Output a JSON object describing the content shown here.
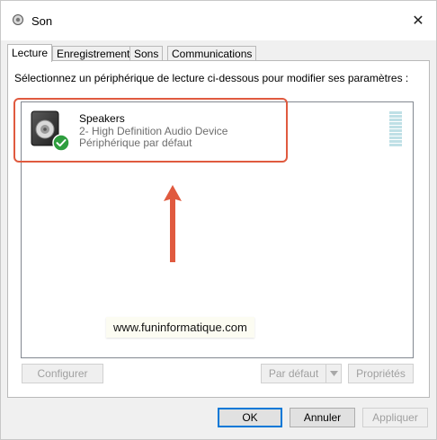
{
  "window": {
    "title": "Son",
    "close_glyph": "✕"
  },
  "tabs": [
    {
      "label": "Lecture",
      "active": true
    },
    {
      "label": "Enregistrement",
      "active": false
    },
    {
      "label": "Sons",
      "active": false
    },
    {
      "label": "Communications",
      "active": false
    }
  ],
  "instruction": "Sélectionnez un périphérique de lecture ci-dessous pour modifier ses paramètres :",
  "device": {
    "name": "Speakers",
    "description": "2- High Definition Audio Device",
    "status": "Périphérique par défaut",
    "icon": "speaker-icon",
    "badge_icon": "checkmark-icon"
  },
  "watermark": "www.funinformatique.com",
  "buttons": {
    "configure": "Configurer",
    "set_default": "Par défaut",
    "properties": "Propriétés",
    "ok": "OK",
    "cancel": "Annuler",
    "apply": "Appliquer"
  },
  "colors": {
    "highlight": "#e05a3f",
    "badge_green": "#2e9e3e",
    "meter": "#bfe0e6",
    "primary_border": "#0078d7"
  }
}
